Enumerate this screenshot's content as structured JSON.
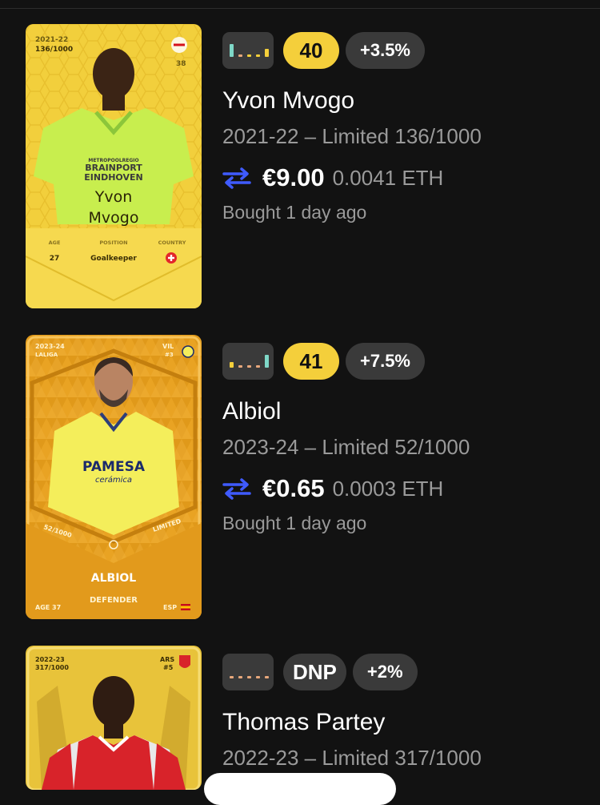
{
  "colors": {
    "background": "#121212",
    "score_yellow": "#f4cf3b",
    "chip_gray": "#3a3a3a",
    "swap_blue": "#3f5bff",
    "muted_text": "#9a9a9a"
  },
  "items": [
    {
      "score": "40",
      "delta": "+3.5%",
      "name": "Yvon Mvogo",
      "meta": "2021-22 – Limited 136/1000",
      "price_eur": "€9.00",
      "price_eth": "0.0041 ETH",
      "bought": "Bought 1 day ago",
      "spark_icon": "sparkline-icon",
      "card": {
        "season": "2021-22",
        "serial": "136/1000",
        "shirt_number": "38",
        "first_name": "Yvon",
        "last_name": "Mvogo",
        "age_label": "AGE",
        "age": "27",
        "position_label": "POSITION",
        "position": "Goalkeeper",
        "country_label": "COUNTRY",
        "sponsor_top": "METROPOOLREGIO",
        "sponsor_1": "BRAINPORT",
        "sponsor_2": "EINDHOVEN"
      }
    },
    {
      "score": "41",
      "delta": "+7.5%",
      "name": "Albiol",
      "meta": "2023-24 – Limited 52/1000",
      "price_eur": "€0.65",
      "price_eth": "0.0003 ETH",
      "bought": "Bought 1 day ago",
      "spark_icon": "sparkline-icon",
      "card": {
        "season": "2023-24",
        "league": "LALIGA",
        "club": "VIL",
        "shirt_number": "#3",
        "serial": "52/1000",
        "rarity": "LIMITED",
        "display_name": "ALBIOL",
        "position": "DEFENDER",
        "age": "AGE 37",
        "country": "ESP",
        "sponsor_1": "PAMESA",
        "sponsor_2": "cerámica"
      }
    },
    {
      "score": "DNP",
      "delta": "+2%",
      "name": "Thomas Partey",
      "meta": "2022-23 – Limited 317/1000",
      "spark_icon": "sparkline-icon",
      "card": {
        "season": "2022-23",
        "serial": "317/1000",
        "club": "ARS",
        "shirt_number": "#5"
      }
    }
  ]
}
